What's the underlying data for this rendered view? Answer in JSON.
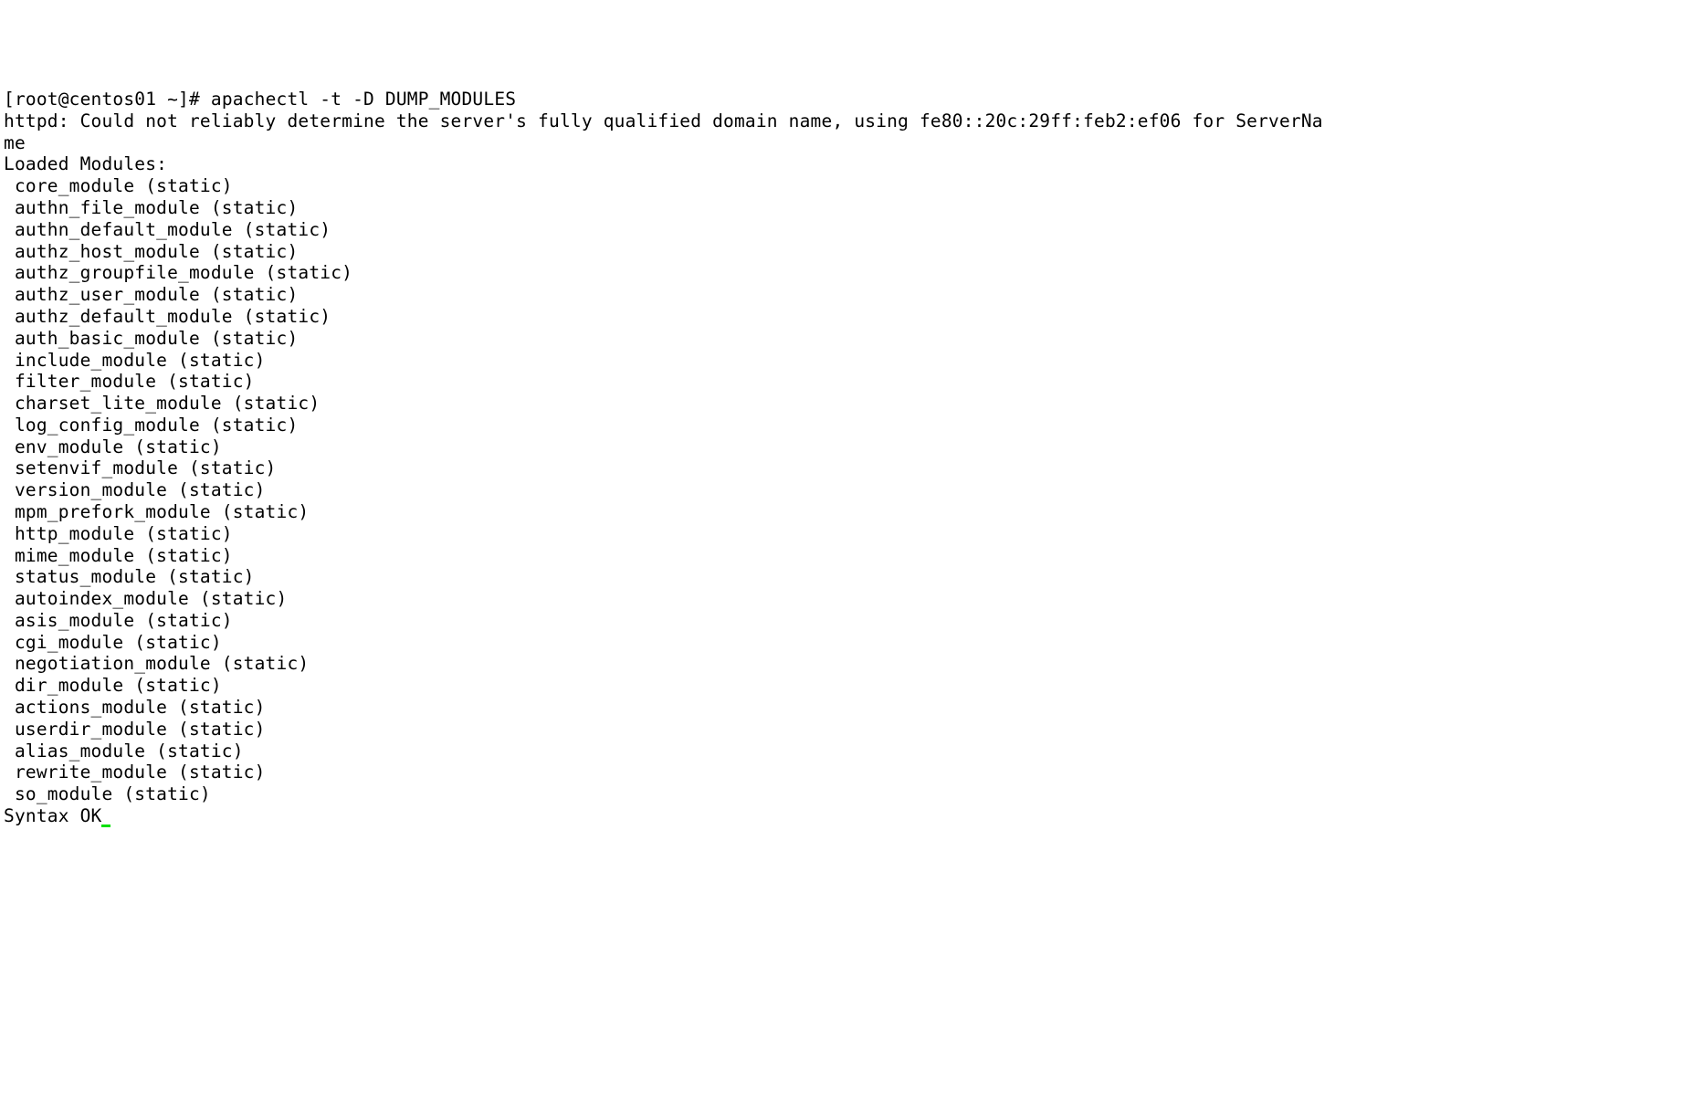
{
  "prompt": "[root@centos01 ~]# ",
  "command": "apachectl -t -D DUMP_MODULES",
  "warning_line": "httpd: Could not reliably determine the server's fully qualified domain name, using fe80::20c:29ff:feb2:ef06 for ServerNa",
  "warning_wrap": "me",
  "header": "Loaded Modules:",
  "modules": [
    "core_module (static)",
    "authn_file_module (static)",
    "authn_default_module (static)",
    "authz_host_module (static)",
    "authz_groupfile_module (static)",
    "authz_user_module (static)",
    "authz_default_module (static)",
    "auth_basic_module (static)",
    "include_module (static)",
    "filter_module (static)",
    "charset_lite_module (static)",
    "log_config_module (static)",
    "env_module (static)",
    "setenvif_module (static)",
    "version_module (static)",
    "mpm_prefork_module (static)",
    "http_module (static)",
    "mime_module (static)",
    "status_module (static)",
    "autoindex_module (static)",
    "asis_module (static)",
    "cgi_module (static)",
    "negotiation_module (static)",
    "dir_module (static)",
    "actions_module (static)",
    "userdir_module (static)",
    "alias_module (static)",
    "rewrite_module (static)",
    "so_module (static)"
  ],
  "footer": "Syntax OK"
}
